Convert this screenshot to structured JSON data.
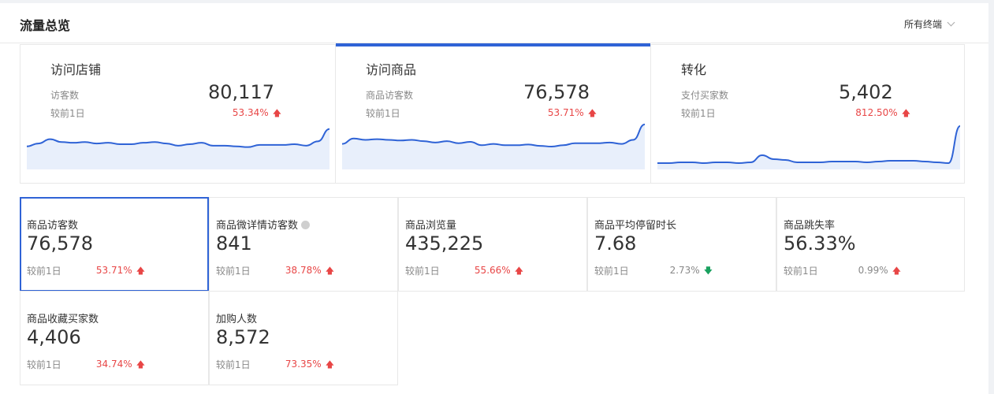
{
  "header": {
    "title": "流量总览",
    "terminal_select": "所有终端"
  },
  "overview": [
    {
      "name": "访问店铺",
      "metric": "访客数",
      "value": "80,117",
      "compare": "较前1日",
      "change": "53.34%",
      "trend": "up",
      "chart_data": {
        "type": "area",
        "values": [
          32,
          36,
          42,
          38,
          37,
          38,
          36,
          37,
          35,
          35,
          37,
          38,
          36,
          33,
          35,
          37,
          33,
          33,
          32,
          31,
          34,
          34,
          34,
          35,
          33,
          39,
          56
        ],
        "ylim": [
          0,
          70
        ]
      }
    },
    {
      "name": "访问商品",
      "metric": "商品访客数",
      "value": "76,578",
      "compare": "较前1日",
      "change": "53.71%",
      "trend": "up",
      "chart_data": {
        "type": "area",
        "values": [
          38,
          46,
          44,
          45,
          44,
          43,
          44,
          42,
          40,
          42,
          39,
          41,
          36,
          38,
          36,
          36,
          37,
          35,
          34,
          36,
          39,
          39,
          39,
          40,
          38,
          44,
          67
        ],
        "ylim": [
          0,
          75
        ]
      }
    },
    {
      "name": "转化",
      "metric": "支付买家数",
      "value": "5,402",
      "compare": "较前1日",
      "change": "812.50%",
      "trend": "up",
      "chart_data": {
        "type": "area",
        "values": [
          8,
          8,
          9,
          9,
          8,
          9,
          9,
          8,
          9,
          18,
          13,
          12,
          9,
          9,
          9,
          10,
          10,
          10,
          9,
          10,
          11,
          11,
          11,
          10,
          9,
          8,
          55
        ],
        "ylim": [
          0,
          64
        ]
      }
    }
  ],
  "metrics": [
    {
      "label": "商品访客数",
      "value": "76,578",
      "compare": "较前1日",
      "change": "53.71%",
      "trend": "up",
      "info": false
    },
    {
      "label": "商品微详情访客数",
      "value": "841",
      "compare": "较前1日",
      "change": "38.78%",
      "trend": "up",
      "info": true
    },
    {
      "label": "商品浏览量",
      "value": "435,225",
      "compare": "较前1日",
      "change": "55.66%",
      "trend": "up",
      "info": false
    },
    {
      "label": "商品平均停留时长",
      "value": "7.68",
      "compare": "较前1日",
      "change": "2.73%",
      "trend": "down",
      "info": false
    },
    {
      "label": "商品跳失率",
      "value": "56.33%",
      "compare": "较前1日",
      "change": "0.99%",
      "trend": "up",
      "info": false
    },
    {
      "label": "商品收藏买家数",
      "value": "4,406",
      "compare": "较前1日",
      "change": "34.74%",
      "trend": "up",
      "info": false
    },
    {
      "label": "加购人数",
      "value": "8,572",
      "compare": "较前1日",
      "change": "73.35%",
      "trend": "up",
      "info": false
    }
  ],
  "colors": {
    "accent": "#2f63d6",
    "up": "#e84646",
    "down": "#19a15f",
    "area_fill": "#e8effb"
  }
}
